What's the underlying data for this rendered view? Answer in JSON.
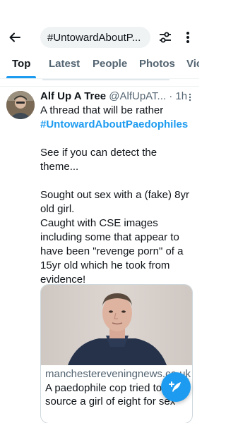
{
  "search": {
    "query": "#UntowardAboutP..."
  },
  "tabs": [
    {
      "label": "Top",
      "active": true
    },
    {
      "label": "Latest",
      "active": false
    },
    {
      "label": "People",
      "active": false
    },
    {
      "label": "Photos",
      "active": false
    },
    {
      "label": "Vic",
      "active": false
    }
  ],
  "tweet": {
    "display_name": "Alf Up A Tree",
    "handle": "@AlfUpAT...",
    "time": "· 1h",
    "text_line1": "A thread that will be rather",
    "hashtag": "#UntowardAboutPaedophiles",
    "text_para2": "See if you can detect the theme...",
    "text_para3a": "Sought out sex with a (fake) 8yr old girl.",
    "text_para3b": "Caught with CSE images including some that appear to have been \"revenge porn\" of a 15yr old which he took from evidence!",
    "card": {
      "domain": "manchestereveningnews.co.uk",
      "title": "A paedophile cop tried to source a girl of eight for sex"
    }
  },
  "colors": {
    "accent": "#1d9bf0",
    "text": "#0f1419",
    "muted": "#536471"
  },
  "icons": [
    "back-arrow-icon",
    "filter-icon",
    "more-icon",
    "compose-icon"
  ]
}
